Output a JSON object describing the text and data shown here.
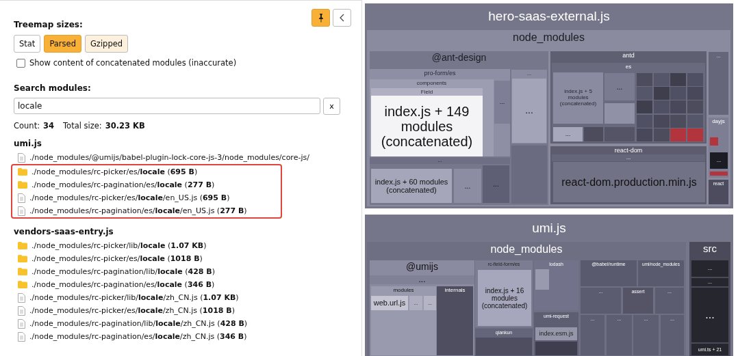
{
  "sidebar": {
    "treemap_sizes": {
      "label": "Treemap sizes:",
      "options": [
        {
          "label": "Stat",
          "selected": false,
          "hover": false
        },
        {
          "label": "Parsed",
          "selected": true,
          "hover": false
        },
        {
          "label": "Gzipped",
          "selected": false,
          "hover": true
        }
      ]
    },
    "concatenated_checkbox": {
      "label": "Show content of concatenated modules (inaccurate)",
      "checked": false
    },
    "search": {
      "label": "Search modules:",
      "value": "locale",
      "clear": "x"
    },
    "count_label": "Count:",
    "count": "34",
    "total_label": "Total size:",
    "total": "30.23 KB",
    "groups": [
      {
        "name": "umi.js",
        "blocks": [
          {
            "highlighted": false,
            "items": [
              {
                "kind": "file",
                "text": "./node_modules/@umijs/babel-plugin-lock-core-js-3/node_modules/core-js/"
              }
            ]
          },
          {
            "highlighted": true,
            "items": [
              {
                "kind": "folder",
                "text": "./node_modules/rc-picker/es/**locale** (**695 B**)"
              },
              {
                "kind": "folder",
                "text": "./node_modules/rc-pagination/es/**locale** (**277 B**)"
              },
              {
                "kind": "file",
                "text": "./node_modules/rc-picker/es/**locale**/en_US.js (**695 B**)"
              },
              {
                "kind": "file",
                "text": "./node_modules/rc-pagination/es/**locale**/en_US.js (**277 B**)"
              }
            ]
          }
        ]
      },
      {
        "name": "vendors-saas-entry.js",
        "blocks": [
          {
            "highlighted": false,
            "items": [
              {
                "kind": "folder",
                "text": "./node_modules/rc-picker/lib/**locale** (**1.07 KB**)"
              },
              {
                "kind": "folder",
                "text": "./node_modules/rc-picker/es/**locale** (**1018 B**)"
              },
              {
                "kind": "folder",
                "text": "./node_modules/rc-pagination/lib/**locale** (**428 B**)"
              },
              {
                "kind": "folder",
                "text": "./node_modules/rc-pagination/es/**locale** (**346 B**)"
              },
              {
                "kind": "file",
                "text": "./node_modules/rc-picker/lib/**locale**/zh_CN.js (**1.07 KB**)"
              },
              {
                "kind": "file",
                "text": "./node_modules/rc-picker/es/**locale**/zh_CN.js (**1018 B**)"
              },
              {
                "kind": "file",
                "text": "./node_modules/rc-pagination/lib/**locale**/zh_CN.js (**428 B**)"
              },
              {
                "kind": "file",
                "text": "./node_modules/rc-pagination/es/**locale**/zh_CN.js (**346 B**)"
              }
            ]
          }
        ]
      }
    ]
  },
  "treemaps": [
    {
      "title": "hero-saas-external.js",
      "cells": [
        {
          "label": "node_modules",
          "children": [
            {
              "label": "@ant-design",
              "children": [
                {
                  "label": "pro-form/es",
                  "children": [
                    {
                      "label": "components",
                      "children": [
                        {
                          "label": "Field",
                          "children": [
                            {
                              "label": "index.js + 149 modules (concatenated)"
                            }
                          ]
                        }
                      ]
                    },
                    {
                      "label": "..."
                    }
                  ]
                },
                {
                  "label": "...",
                  "children": [
                    {
                      "label": "..."
                    }
                  ]
                },
                {
                  "label": "..."
                },
                {
                  "label": "index.js + 60 modules (concatenated)"
                },
                {
                  "label": "..."
                },
                {
                  "label": "..."
                }
              ]
            },
            {
              "label": "antd",
              "children": [
                {
                  "label": "es",
                  "children": [
                    {
                      "label": "index.js + 5 modules (concatenated)"
                    },
                    {
                      "label": "..."
                    },
                    {
                      "label": "..."
                    }
                  ]
                }
              ]
            },
            {
              "label": "react-dom",
              "children": [
                {
                  "label": "..."
                },
                {
                  "label": "react-dom.production.min.js"
                }
              ]
            },
            {
              "label": "..."
            },
            {
              "label": "dayjs",
              "children": [
                {
                  "label": "..."
                }
              ]
            },
            {
              "label": "react"
            }
          ]
        }
      ]
    },
    {
      "title": "umi.js",
      "cells": [
        {
          "label": "node_modules",
          "children": [
            {
              "label": "@umijs",
              "children": [
                {
                  "label": "..."
                },
                {
                  "label": "modules",
                  "children": [
                    {
                      "label": "web.url.js"
                    },
                    {
                      "label": "..."
                    },
                    {
                      "label": "..."
                    }
                  ]
                },
                {
                  "label": "internals"
                }
              ]
            },
            {
              "label": "rc-field-form/es",
              "children": [
                {
                  "label": "index.js + 16 modules (concatenated)"
                }
              ]
            },
            {
              "label": "qiankun"
            },
            {
              "label": "lodash"
            },
            {
              "label": "umi-request",
              "children": [
                {
                  "label": "index.esm.js"
                }
              ]
            },
            {
              "label": "@babel/runtime"
            },
            {
              "label": "umi/node_modules"
            },
            {
              "label": "..."
            },
            {
              "label": "assert"
            },
            {
              "label": "..."
            },
            {
              "label": "..."
            },
            {
              "label": "..."
            },
            {
              "label": "..."
            },
            {
              "label": "..."
            }
          ]
        },
        {
          "label": "src",
          "children": [
            {
              "label": "..."
            },
            {
              "label": "..."
            },
            {
              "label": "..."
            },
            {
              "label": "umi.ts + 21"
            }
          ]
        }
      ]
    }
  ]
}
